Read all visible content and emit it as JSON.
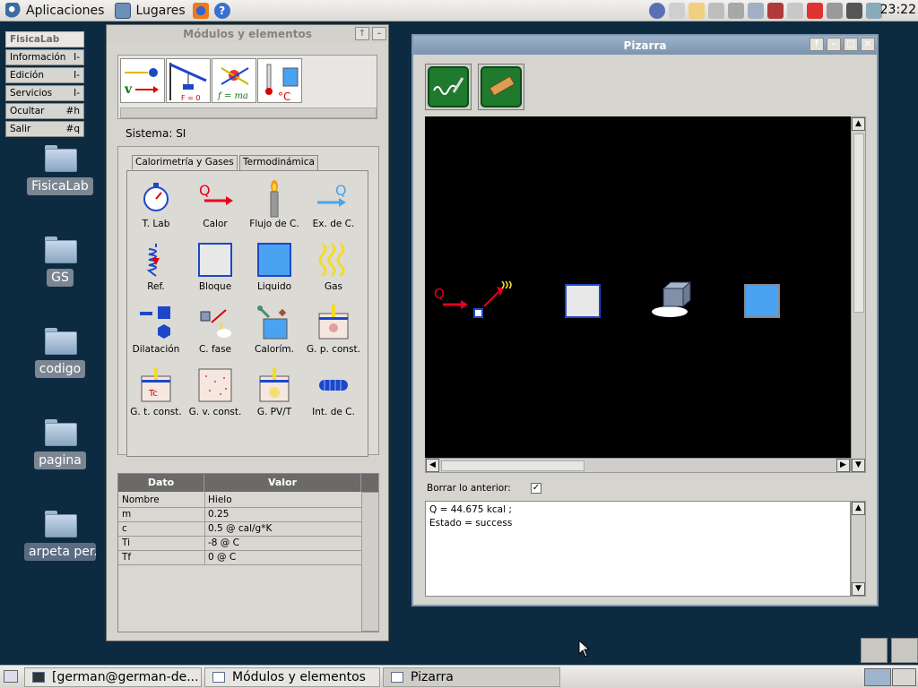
{
  "top_panel": {
    "applications": "Aplicaciones",
    "places": "Lugares",
    "clock": "23:22"
  },
  "desktop_menu": [
    {
      "label": "FisicaLab",
      "shortcut": ""
    },
    {
      "label": "Información",
      "shortcut": "I-"
    },
    {
      "label": "Edición",
      "shortcut": "I-"
    },
    {
      "label": "Servicios",
      "shortcut": "I-"
    },
    {
      "label": "Ocultar",
      "shortcut": "#h"
    },
    {
      "label": "Salir",
      "shortcut": "#q"
    }
  ],
  "desktop_icons": [
    {
      "label": "FisicaLab"
    },
    {
      "label": "GS"
    },
    {
      "label": "codigo"
    },
    {
      "label": "pagina"
    },
    {
      "label": "arpeta per..."
    }
  ],
  "modules_window": {
    "title": "Módulos y elementos",
    "sistema": "Sistema: SI",
    "tabs": [
      "Calorimetría y Gases",
      "Termodinámica"
    ],
    "elements": [
      "T. Lab",
      "Calor",
      "Flujo de C.",
      "Ex. de C.",
      "Ref.",
      "Bloque",
      "Liquido",
      "Gas",
      "Dilatación",
      "C. fase",
      "Calorím.",
      "G. p. const.",
      "G. t. const.",
      "G. v. const.",
      "G. PV/T",
      "Int. de C."
    ],
    "table": {
      "headers": [
        "Dato",
        "Valor"
      ],
      "rows": [
        [
          "Nombre",
          "Hielo"
        ],
        [
          "m",
          "0.25"
        ],
        [
          "c",
          "0.5 @ cal/g*K"
        ],
        [
          "Ti",
          "-8 @ C"
        ],
        [
          "Tf",
          "0 @ C"
        ]
      ]
    }
  },
  "pizarra_window": {
    "title": "Pizarra",
    "borrar_label": "Borrar lo anterior:",
    "output_lines": [
      "Q  =  44.675  kcal ;",
      "Estado = success"
    ]
  },
  "taskbar": [
    {
      "label": "[german@german-de..."
    },
    {
      "label": "Módulos y elementos"
    },
    {
      "label": "Pizarra"
    }
  ],
  "colors": {
    "desktop": "#0d2b40",
    "heat_red": "#e8001c",
    "liquid_blue": "#4aa3f0",
    "block_gray": "#e8e8e8"
  }
}
